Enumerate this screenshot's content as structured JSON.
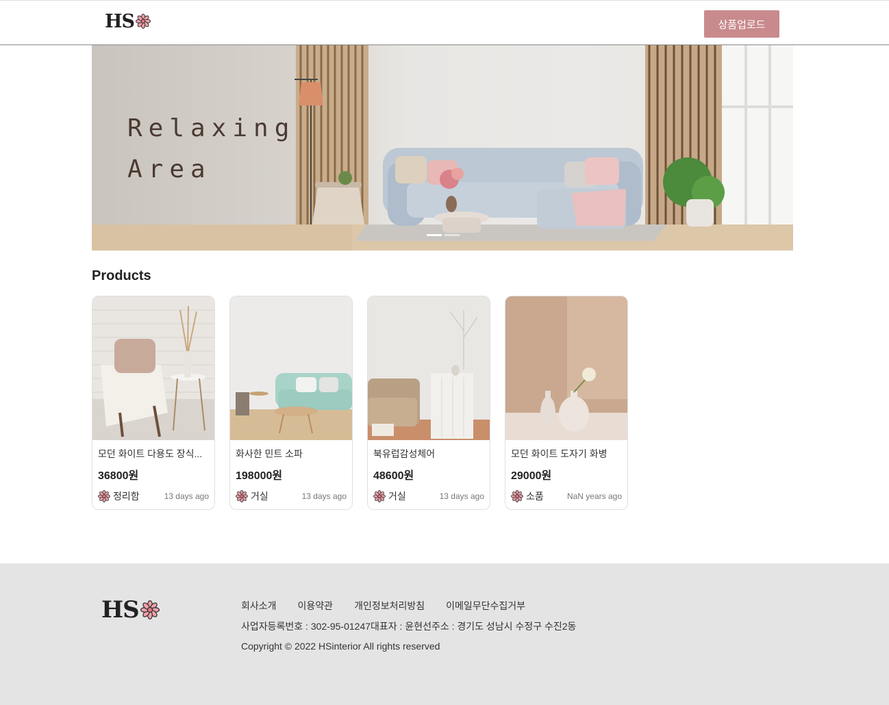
{
  "header": {
    "logo_text": "HS",
    "upload_button": "상품업로드"
  },
  "banner": {
    "line1": "Relaxing",
    "line2": "Area",
    "slides": 2,
    "active_slide": 0
  },
  "products": {
    "title": "Products",
    "items": [
      {
        "name": "모던 화이트 다용도 장식...",
        "price": "36800원",
        "seller": "정리함",
        "date": "13 days ago"
      },
      {
        "name": "화사한 민트 소파",
        "price": "198000원",
        "seller": "거실",
        "date": "13 days ago"
      },
      {
        "name": "북유럽감성체어",
        "price": "48600원",
        "seller": "거실",
        "date": "13 days ago"
      },
      {
        "name": "모던 화이트 도자기 화병",
        "price": "29000원",
        "seller": "소품",
        "date": "NaN years ago"
      }
    ]
  },
  "footer": {
    "logo_text": "HS",
    "links": [
      "회사소개",
      "이용약관",
      "개인정보처리방침",
      "이메일무단수집거부"
    ],
    "info": "사업자등록번호 : 302-95-01247대표자 : 윤현선주소 : 경기도 성남시 수정구 수진2동",
    "copyright": "Copyright © 2022 HSinterior All rights reserved"
  },
  "colors": {
    "accent": "#c98a8d",
    "footer_bg": "#e4e4e4",
    "flower_fill": "#f0a0a8"
  },
  "icons": {
    "logo_mark": "flower-icon",
    "seller_avatar": "flower-icon"
  }
}
